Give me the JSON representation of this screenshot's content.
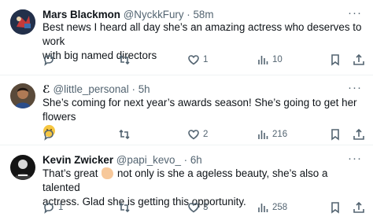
{
  "tweets": [
    {
      "name": "Mars Blackmon",
      "handle": "@NyckkFury",
      "dot": "·",
      "time": "58m",
      "text_lines": [
        "Best news I heard all day she’s an amazing actress who deserves to work",
        "with big named directors"
      ],
      "replies": "",
      "retweets": "",
      "likes": "1",
      "views": "10"
    },
    {
      "name": "",
      "name_glyph": "ℰ",
      "handle": "@little_personal",
      "dot": "·",
      "time": "5h",
      "text_lines": [
        "She’s coming for next year’s awards season! She’s going to get her flowers"
      ],
      "replies": "",
      "retweets": "",
      "likes": "2",
      "views": "216"
    },
    {
      "name": "Kevin Zwicker",
      "handle": "@papi_kevo_",
      "dot": "·",
      "time": "6h",
      "text_lines": [
        "That’s great",
        "not only is she a ageless beauty, she’s also a talented",
        "actress. Glad she is getting this opportunity."
      ],
      "replies": "1",
      "retweets": "",
      "likes": "3",
      "views": "258"
    }
  ],
  "more_label": "···",
  "icons": {
    "reply": "reply-icon",
    "retweet": "retweet-icon",
    "like": "heart-icon",
    "views": "views-icon",
    "bookmark": "bookmark-icon",
    "share": "share-icon"
  },
  "colors": {
    "secondary_text": "#536471",
    "divider": "#eff3f4"
  }
}
